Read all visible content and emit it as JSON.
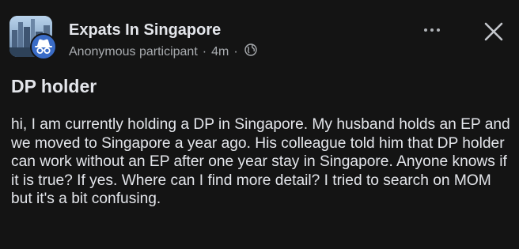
{
  "header": {
    "group_name": "Expats In Singapore",
    "author": "Anonymous participant",
    "separator": "·",
    "time": "4m",
    "privacy_icon": "globe-icon",
    "group_avatar_icon": "city-skyline-avatar",
    "author_avatar_icon": "incognito-icon",
    "more_icon": "more-dots-icon",
    "close_icon": "close-icon"
  },
  "post": {
    "title": "DP holder",
    "body": "hi, I am currently holding a DP in Singapore. My husband holds an EP and we moved to Singapore a year ago. His colleague told him that DP holder can work without an EP after one year stay in Singapore. Anyone knows if it is true? If yes. Where can I find more detail? I tried to search on MOM but it's a bit confusing."
  },
  "colors": {
    "background": "#141414",
    "primary_text": "#e4e6eb",
    "secondary_text": "#a8abaf",
    "anonymous_badge": "#3a6cc7"
  }
}
